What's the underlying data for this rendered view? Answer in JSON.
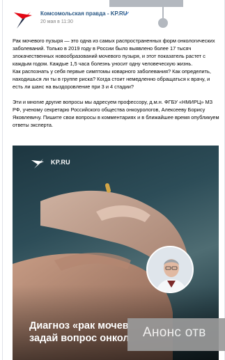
{
  "overlay": {
    "top_label": "",
    "banner_text": "Анонс отв"
  },
  "post": {
    "author": "Комсомольская правда - KP.RU",
    "date": "20 мая в 11:30",
    "paragraphs": [
      "Рак мочевого пузыря — это одна из самых распространенных форм онкологических заболеваний. Только в 2019 году в России было выявлено более 17 тысяч злокачественных новообразований мочевого пузыря, и этот показатель растет с каждым годом. Каждые 1,5 часа болезнь уносит одну человеческую жизнь.",
      "Как распознать у себя первые симптомы коварного заболевания? Как определить, находишься ли ты в группе риска? Когда стоит немедленно обращаться к врачу, и есть ли шанс на выздоровление при 3 и 4 стадии?",
      "Эти и многие другие вопросы мы адресуем профессору, д.м.н. ФГБУ «НМИРЦ» МЗ РФ, ученому секретарю Российского общества онкоурологов, Алексееву Борису Яковлевичу. Пишите свои вопросы в комментариях и в ближайшее время опубликуем ответы эксперта."
    ]
  },
  "media": {
    "logo_text": "KP.RU",
    "caption_line1": "Диагноз «рак мочев",
    "caption_line2": "задай вопрос онкол"
  },
  "colors": {
    "author_link": "#2a5885",
    "overlay_gray": "#b3b8bf",
    "banner_gray": "#9a9a9a"
  }
}
